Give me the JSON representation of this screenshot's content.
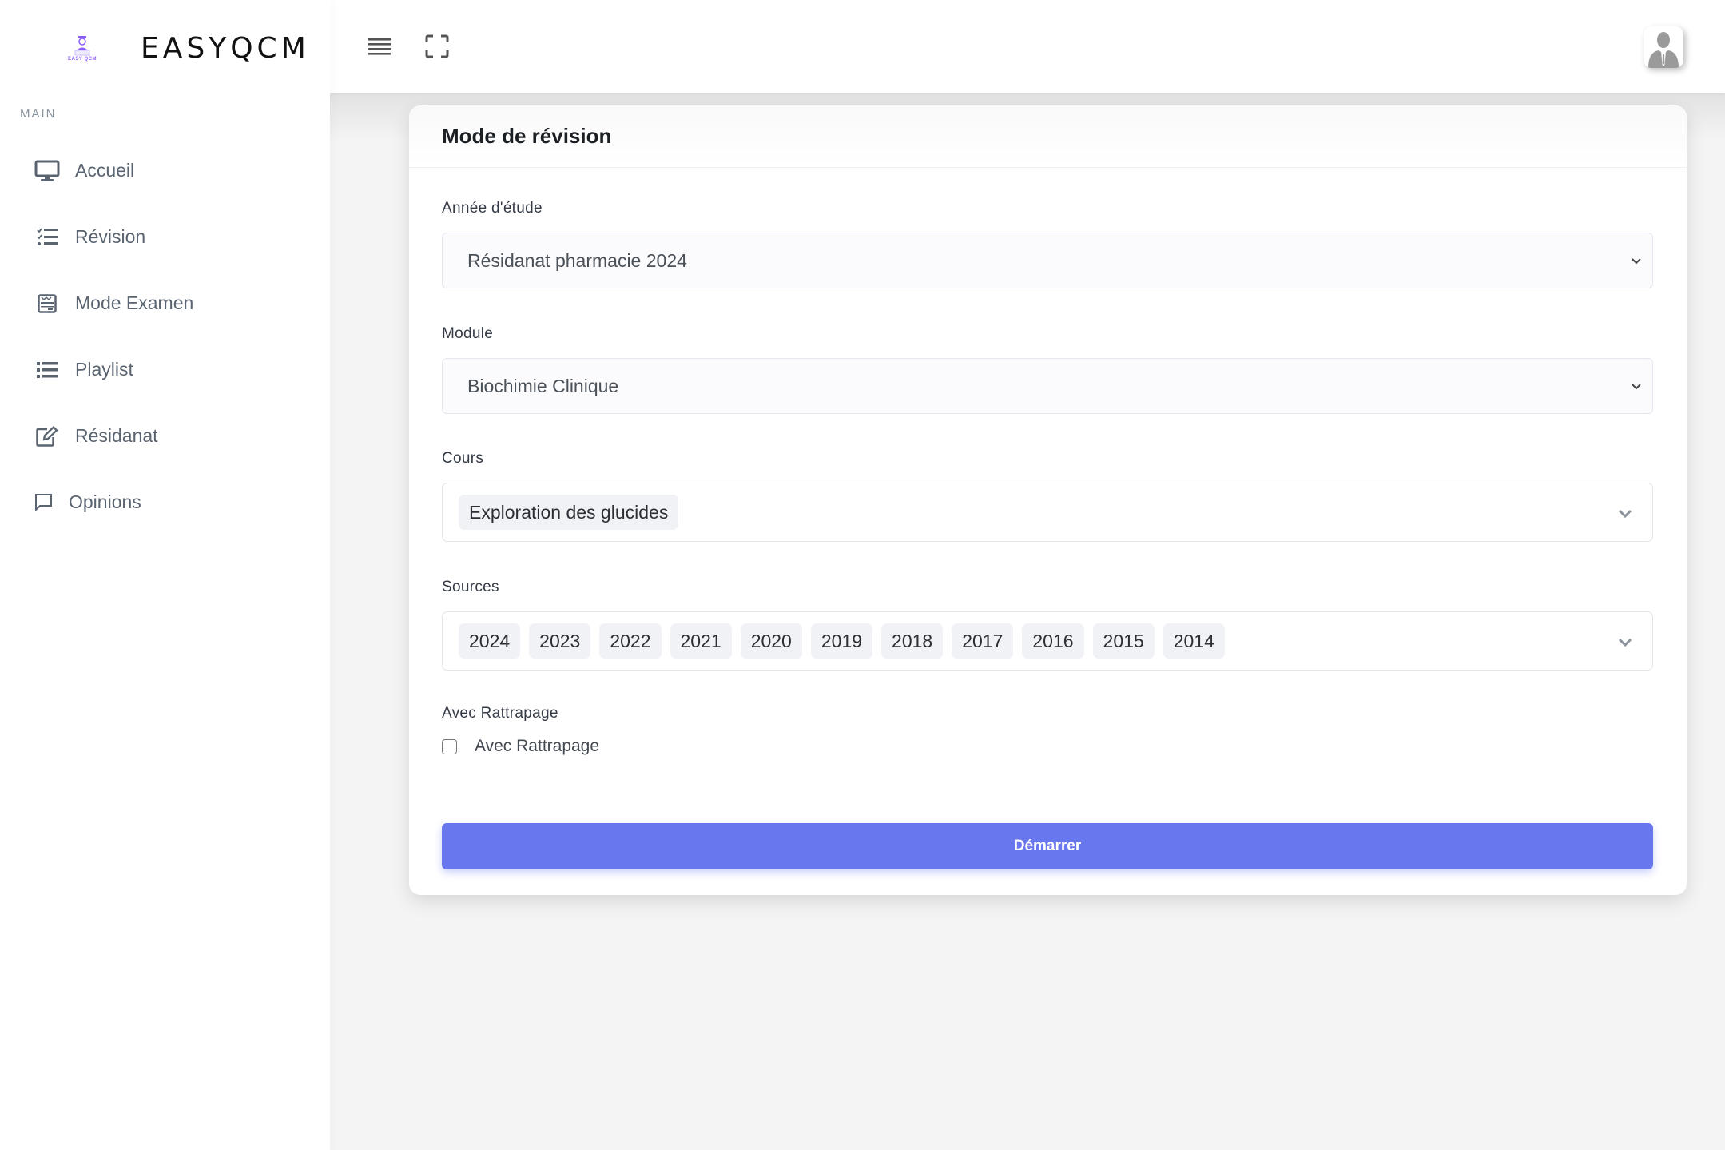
{
  "brand": {
    "name": "EASYQCM",
    "logo_caption": "EASY QCM",
    "accent_color": "#8b5cf6"
  },
  "sidebar": {
    "section_title": "MAIN",
    "items": [
      {
        "label": "Accueil",
        "icon": "desktop-icon"
      },
      {
        "label": "Révision",
        "icon": "checklist-icon"
      },
      {
        "label": "Mode Examen",
        "icon": "exam-calendar-icon"
      },
      {
        "label": "Playlist",
        "icon": "list-icon"
      },
      {
        "label": "Résidanat",
        "icon": "edit-icon"
      },
      {
        "label": "Opinions",
        "icon": "comment-icon"
      }
    ]
  },
  "topbar": {
    "menu_icon": "hamburger-icon",
    "fullscreen_icon": "fullscreen-icon",
    "avatar_icon": "user-avatar-icon"
  },
  "card": {
    "title": "Mode de révision",
    "annee": {
      "label": "Année d'étude",
      "selected": "Résidanat pharmacie 2024"
    },
    "module": {
      "label": "Module",
      "selected": "Biochimie Clinique"
    },
    "cours": {
      "label": "Cours",
      "selected": [
        "Exploration des glucides"
      ]
    },
    "sources": {
      "label": "Sources",
      "selected": [
        "2024",
        "2023",
        "2022",
        "2021",
        "2020",
        "2019",
        "2018",
        "2017",
        "2016",
        "2015",
        "2014"
      ]
    },
    "rattrapage": {
      "label": "Avec Rattrapage",
      "checkbox_label": "Avec Rattrapage",
      "checked": false
    },
    "start_button": {
      "label": "Démarrer",
      "color": "#6877ee"
    }
  }
}
